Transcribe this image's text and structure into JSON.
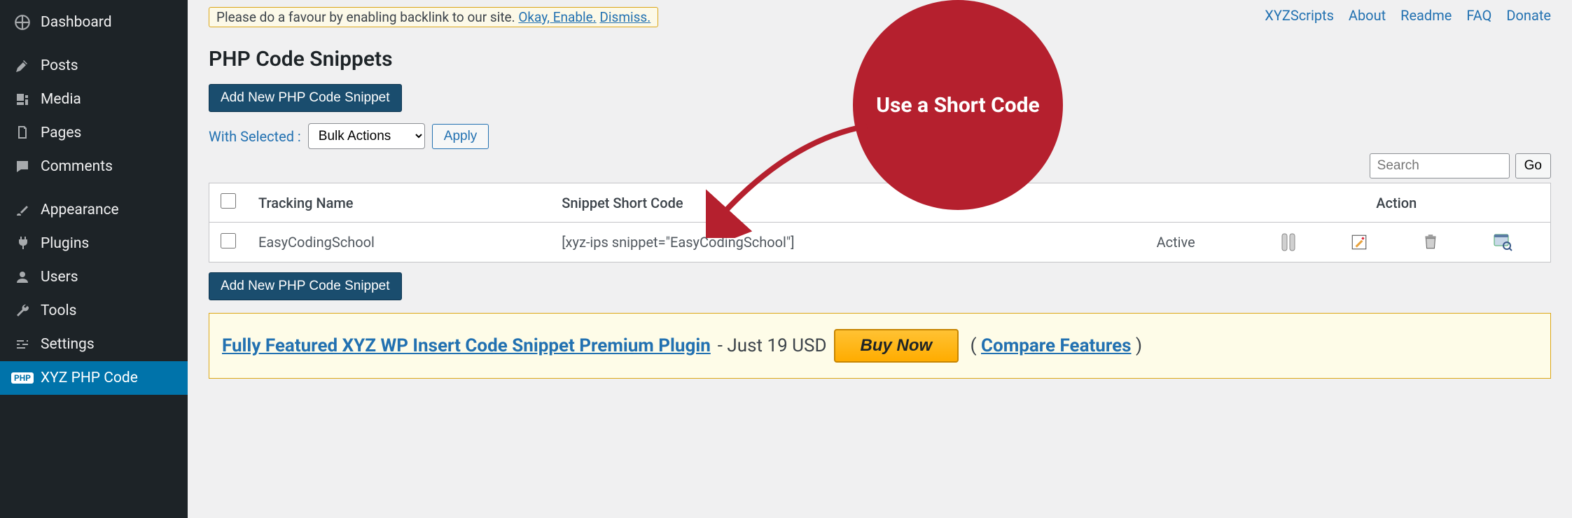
{
  "notice": {
    "text_prefix": "Please do a favour by enabling backlink to our site. ",
    "ok": "Okay, Enable.",
    "dismiss": "Dismiss."
  },
  "top_links": [
    "XYZScripts",
    "About",
    "Readme",
    "FAQ",
    "Donate"
  ],
  "page_title": "PHP Code Snippets",
  "buttons": {
    "add_new": "Add New PHP Code Snippet",
    "apply": "Apply",
    "go": "Go",
    "buy_now": "Buy Now"
  },
  "bulk": {
    "label": "With Selected :",
    "selected": "Bulk Actions"
  },
  "search": {
    "placeholder": "Search"
  },
  "table": {
    "headers": {
      "name": "Tracking Name",
      "shortcode": "Snippet Short Code",
      "action": "Action"
    },
    "rows": [
      {
        "name": "EasyCodingSchool",
        "shortcode": "[xyz-ips snippet=\"EasyCodingSchool\"]",
        "status": "Active"
      }
    ]
  },
  "promo": {
    "link_text": "Fully Featured XYZ WP Insert Code Snippet Premium Plugin",
    "suffix": " - Just 19 USD ",
    "compare": "Compare Features"
  },
  "callout": "Use a Short Code",
  "sidebar": {
    "items": [
      {
        "label": "Dashboard"
      },
      {
        "label": "Posts"
      },
      {
        "label": "Media"
      },
      {
        "label": "Pages"
      },
      {
        "label": "Comments"
      },
      {
        "label": "Appearance"
      },
      {
        "label": "Plugins"
      },
      {
        "label": "Users"
      },
      {
        "label": "Tools"
      },
      {
        "label": "Settings"
      },
      {
        "label": "XYZ PHP Code"
      }
    ]
  }
}
